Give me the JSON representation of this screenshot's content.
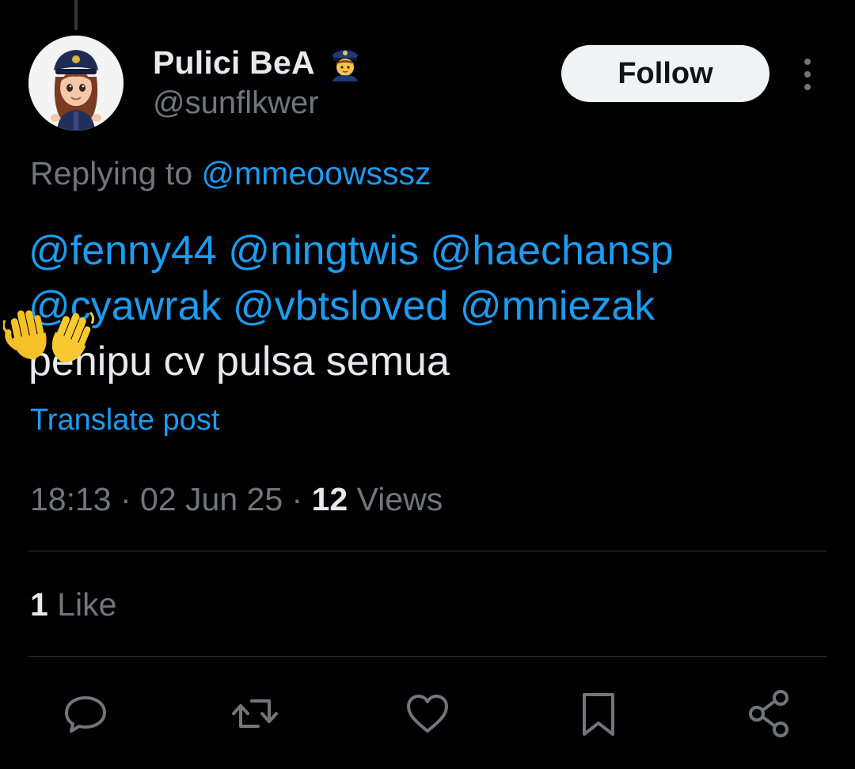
{
  "author": {
    "display_name": "Pulici BeA",
    "handle": "@sunflkwer",
    "name_emoji": "police-officer-emoji"
  },
  "follow_label": "Follow",
  "reply": {
    "prefix": "Replying to ",
    "handle": "@mmeoowsssz"
  },
  "tweet": {
    "mentions_line1": [
      "@fenny44",
      "@ningtwis",
      "@haechansp"
    ],
    "mentions_line2": [
      "@cyawrak",
      "@vbtsloved",
      "@mniezak"
    ],
    "body": "penipu cv pulsa semua",
    "overlay_emoji": "waving-hands-emoji"
  },
  "translate_label": "Translate post",
  "meta": {
    "time": "18:13",
    "sep": " · ",
    "date": "02 Jun 25",
    "views_count": "12",
    "views_label": " Views"
  },
  "likes": {
    "count": "1",
    "label": " Like"
  },
  "actions": [
    "reply-icon",
    "repost-icon",
    "like-icon",
    "bookmark-icon",
    "share-icon"
  ],
  "colors": {
    "background": "#000000",
    "text_primary": "#e7e9ea",
    "text_secondary": "#71767b",
    "link": "#1d9bf0",
    "follow_bg": "#eff3f4",
    "divider": "#2f3336"
  }
}
